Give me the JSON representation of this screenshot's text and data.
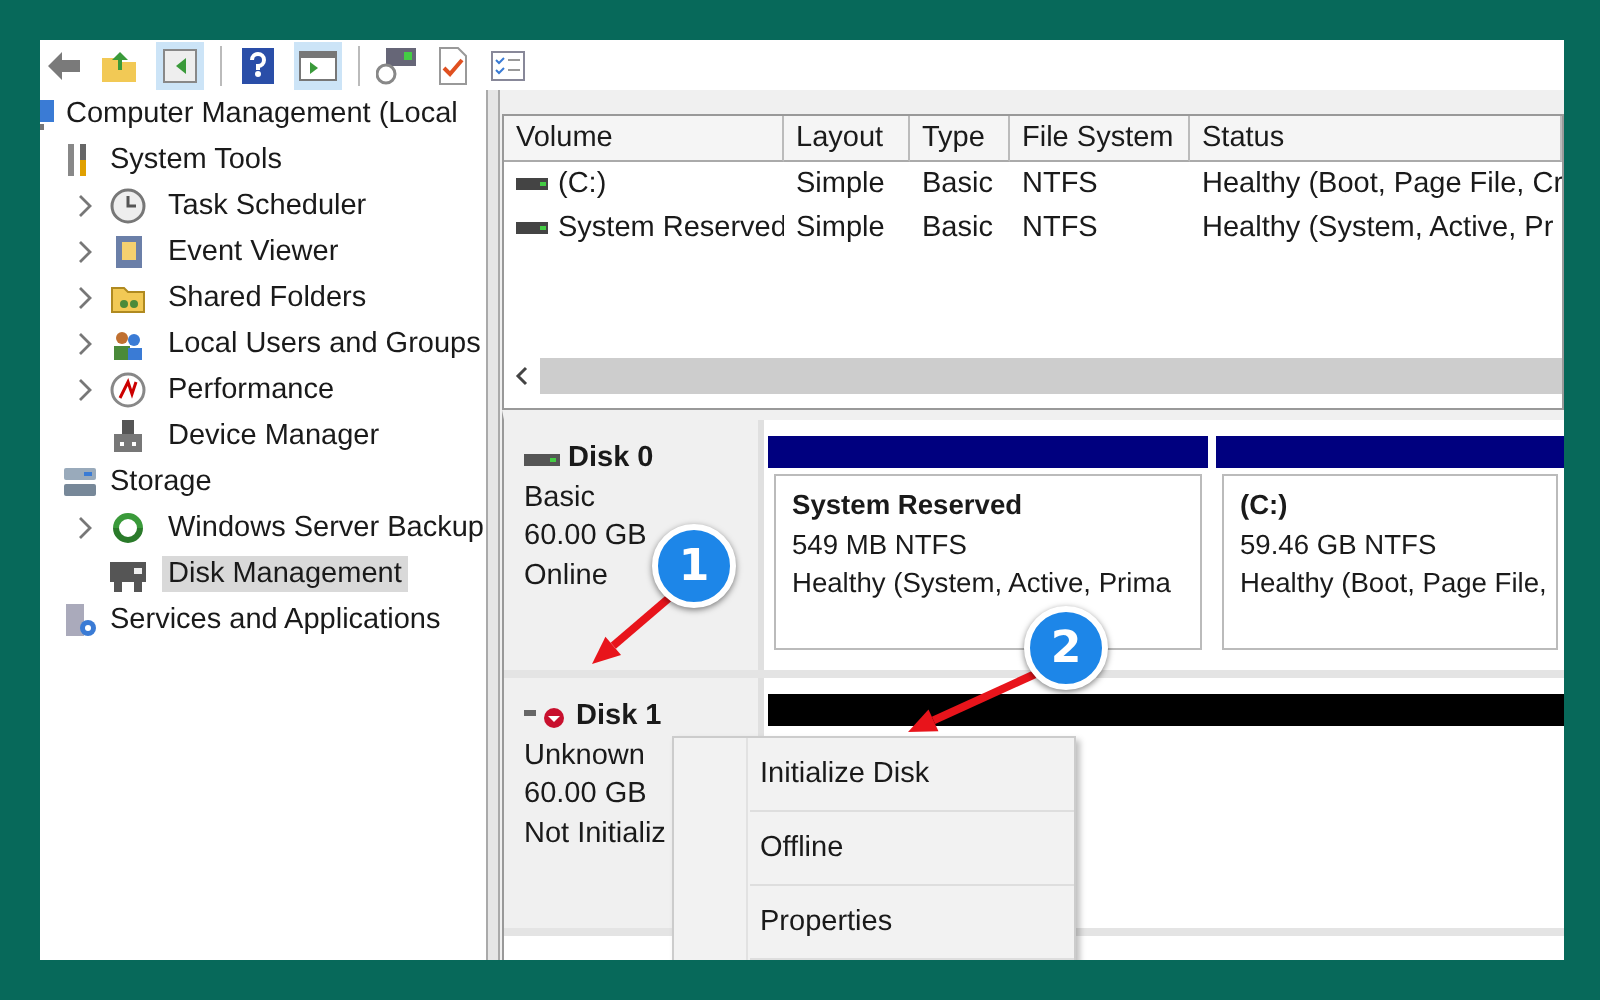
{
  "tree": {
    "items": [
      {
        "label": "Computer Management (Local",
        "kind": "computer",
        "selected": false,
        "children": [
          {
            "label": "System Tools",
            "kind": "tools",
            "selected": false,
            "children": [
              {
                "label": "Task Scheduler",
                "kind": "clock",
                "collapsed": true,
                "selected": false
              },
              {
                "label": "Event Viewer",
                "kind": "log",
                "collapsed": true,
                "selected": false
              },
              {
                "label": "Shared Folders",
                "kind": "folder",
                "collapsed": true,
                "selected": false
              },
              {
                "label": "Local Users and Groups",
                "kind": "users",
                "collapsed": true,
                "selected": false
              },
              {
                "label": "Performance",
                "kind": "gauge",
                "collapsed": true,
                "selected": false
              },
              {
                "label": "Device Manager",
                "kind": "device",
                "collapsed": false,
                "selected": false
              }
            ]
          },
          {
            "label": "Storage",
            "kind": "storage",
            "selected": false,
            "children": [
              {
                "label": "Windows Server Backup",
                "kind": "backup",
                "collapsed": true,
                "selected": false
              },
              {
                "label": "Disk Management",
                "kind": "disk",
                "collapsed": false,
                "selected": true
              }
            ]
          },
          {
            "label": "Services and Applications",
            "kind": "services",
            "selected": false
          }
        ]
      }
    ]
  },
  "volumes": {
    "columns": [
      "Volume",
      "Layout",
      "Type",
      "File System",
      "Status"
    ],
    "rows": [
      {
        "cells": [
          "(C:)",
          "Simple",
          "Basic",
          "NTFS",
          "Healthy (Boot, Page File, Cr"
        ]
      },
      {
        "cells": [
          "System Reserved",
          "Simple",
          "Basic",
          "NTFS",
          "Healthy (System, Active, Pr"
        ]
      }
    ]
  },
  "disks": [
    {
      "name": "Disk 0",
      "error": false,
      "type": "Basic",
      "size": "60.00 GB",
      "status": "Online",
      "partitions": [
        {
          "name": "System Reserved",
          "size": "549 MB NTFS",
          "status": "Healthy (System, Active, Prima",
          "color": "#00007f"
        },
        {
          "name": "(C:)",
          "size": "59.46 GB NTFS",
          "status": "Healthy (Boot, Page File,",
          "color": "#00007f"
        }
      ]
    },
    {
      "name": "Disk 1",
      "error": true,
      "type": "Unknown",
      "size": "60.00 GB",
      "status": "Not Initializ",
      "partitions": [
        {
          "color": "#000000"
        }
      ]
    }
  ],
  "context_menu": {
    "items": [
      "Initialize Disk",
      "Offline",
      "Properties"
    ]
  },
  "callouts": [
    {
      "number": "1"
    },
    {
      "number": "2"
    }
  ]
}
